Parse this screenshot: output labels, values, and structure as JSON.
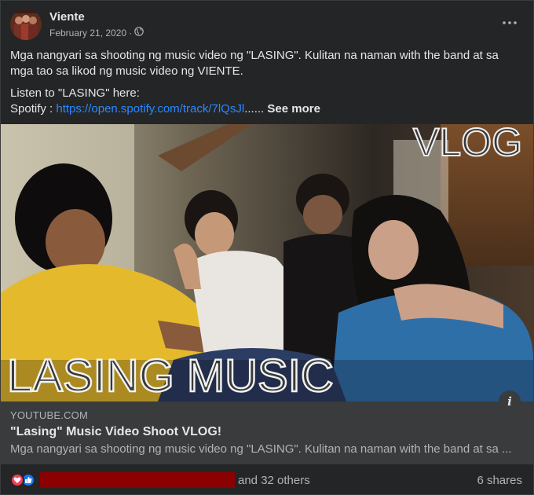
{
  "post": {
    "author": "Viente",
    "date": "February 21, 2020",
    "separator": "·",
    "privacy_icon": "globe-icon",
    "more_icon": "more-options-icon",
    "text_line1": "Mga nangyari sa shooting ng music video ng \"LASING\". Kulitan na naman with the band at sa mga tao sa likod ng music video ng VIENTE.",
    "text_line2": "Listen to \"LASING\" here:",
    "spotify_prefix": "Spotify : ",
    "spotify_link": "https://open.spotify.com/track/7lQsJl",
    "ellipsis": "......",
    "see_more": "See more"
  },
  "media": {
    "overlay_top": "VLOG",
    "overlay_bottom": "LASING MUSIC",
    "info_label": "i"
  },
  "link_preview": {
    "domain": "YOUTUBE.COM",
    "title": "\"Lasing\" Music Video Shoot VLOG!",
    "description": "Mga nangyari sa shooting ng music video ng \"LASING\". Kulitan na naman with the band at sa ..."
  },
  "footer": {
    "reactions": [
      "love-reaction-icon",
      "like-reaction-icon"
    ],
    "others_text": "and 32 others",
    "shares_text": "6 shares"
  },
  "colors": {
    "card_bg": "#242526",
    "link_blue": "#2d88ff",
    "link_box_bg": "#3a3b3c",
    "redaction": "#8b0000",
    "love": "#f33e58",
    "like": "#1877f2"
  }
}
